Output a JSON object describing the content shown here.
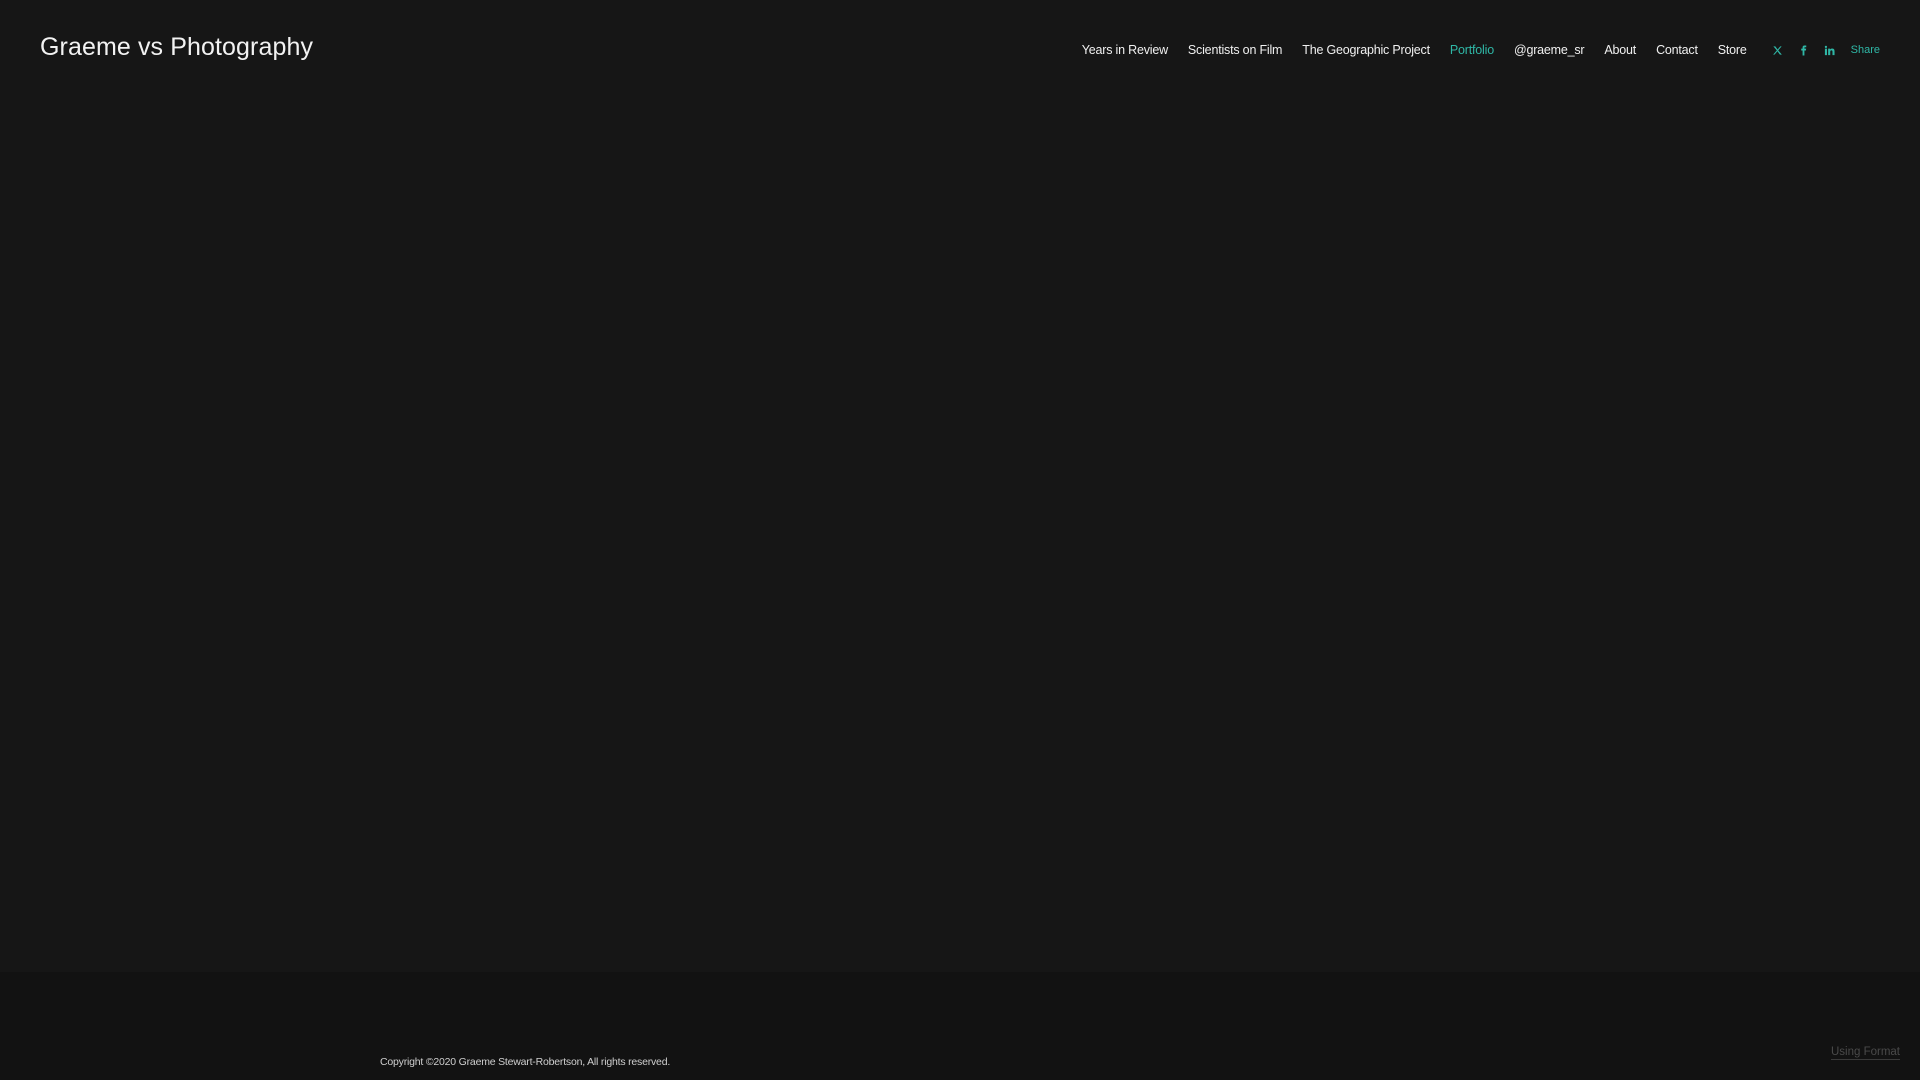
{
  "header": {
    "site_title": "Graeme vs Photography",
    "nav": [
      {
        "label": "Years in Review",
        "active": false
      },
      {
        "label": "Scientists on Film",
        "active": false
      },
      {
        "label": "The Geographic Project",
        "active": false
      },
      {
        "label": "Portfolio",
        "active": true
      },
      {
        "label": "@graeme_sr",
        "active": false
      },
      {
        "label": "About",
        "active": false
      },
      {
        "label": "Contact",
        "active": false
      },
      {
        "label": "Store",
        "active": false
      }
    ],
    "social": [
      {
        "icon": "x-icon"
      },
      {
        "icon": "facebook-icon"
      },
      {
        "icon": "linkedin-icon"
      }
    ],
    "share_label": "Share"
  },
  "footer": {
    "copyright": "Copyright ©2020 Graeme Stewart-Robertson, All rights reserved.",
    "using_format": "Using Format"
  },
  "colors": {
    "background": "#161616",
    "footer_background": "#121212",
    "accent": "#2fb7a6",
    "text": "#f0f0f0"
  }
}
